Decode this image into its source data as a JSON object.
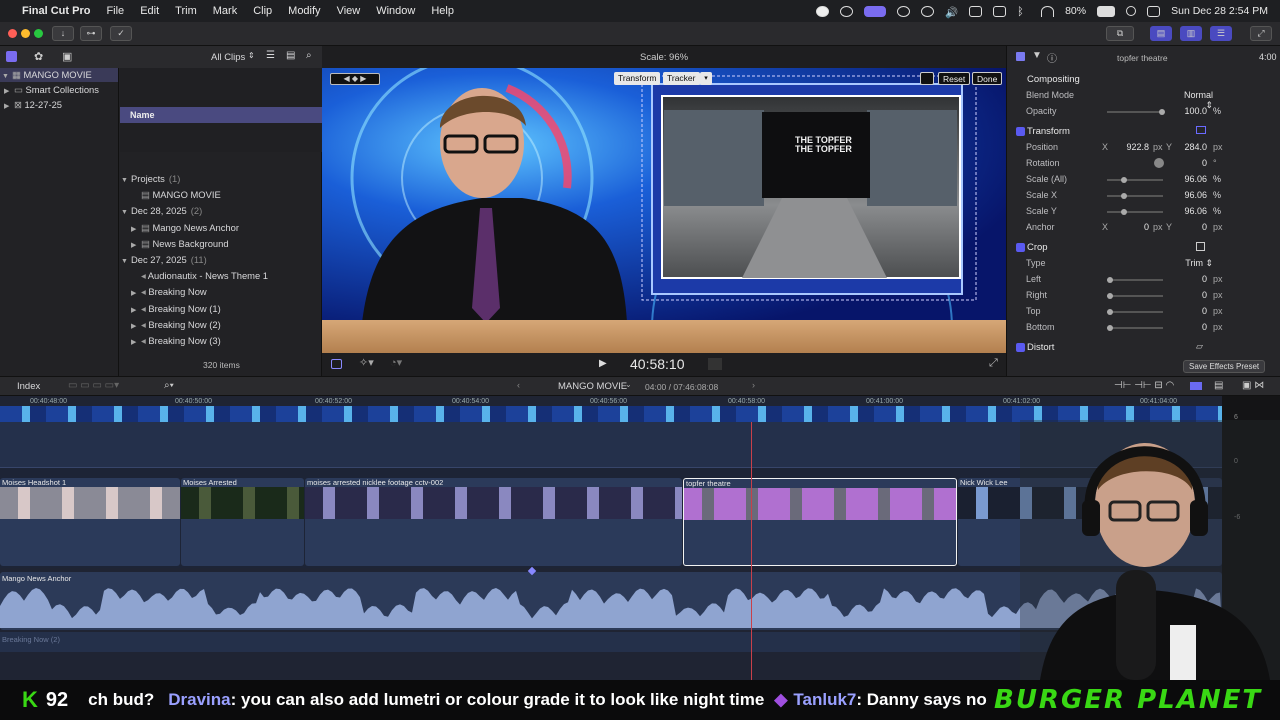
{
  "menubar": {
    "app": "Final Cut Pro",
    "items": [
      "File",
      "Edit",
      "Trim",
      "Mark",
      "Clip",
      "Modify",
      "View",
      "Window",
      "Help"
    ],
    "battery": "80%",
    "datetime": "Sun Dec 28  2:54 PM"
  },
  "browser": {
    "filter": "All Clips",
    "library": "MANGO MOVIE",
    "library_items": [
      "Smart Collections",
      "12-27-25"
    ],
    "column_name": "Name",
    "rows": [
      {
        "label": "Projects",
        "count": "(1)",
        "level": 0,
        "group": true
      },
      {
        "label": "MANGO MOVIE",
        "level": 1
      },
      {
        "label": "Dec 28, 2025",
        "count": "(2)",
        "level": 0,
        "group": true
      },
      {
        "label": "Mango News Anchor",
        "level": 1
      },
      {
        "label": "News Background",
        "level": 1
      },
      {
        "label": "Dec 27, 2025",
        "count": "(11)",
        "level": 0,
        "group": true
      },
      {
        "label": "Audionautix - News Theme 1",
        "level": 1
      },
      {
        "label": "Breaking Now",
        "level": 1
      },
      {
        "label": "Breaking Now (1)",
        "level": 1
      },
      {
        "label": "Breaking Now (2)",
        "level": 1
      },
      {
        "label": "Breaking Now (3)",
        "level": 1
      }
    ],
    "items_count": "320 items"
  },
  "viewer": {
    "scale": "Scale: 96%",
    "transform_btn": "Transform",
    "tracker_btn": "Tracker",
    "reset_btn": "Reset",
    "done_btn": "Done",
    "timecode": "40:58:10",
    "screen_text": "THE TOPFER"
  },
  "inspector": {
    "clip": "topfer theatre",
    "duration": "4:00",
    "compositing": "Compositing",
    "blend_label": "Blend Mode",
    "blend_value": "Normal",
    "opacity_label": "Opacity",
    "opacity_value": "100.0",
    "transform": "Transform",
    "position_label": "Position",
    "pos_x": "922.8",
    "pos_y": "284.0",
    "rotation_label": "Rotation",
    "rotation_value": "0",
    "scale_all_label": "Scale (All)",
    "scale_all": "96.06",
    "scale_x_label": "Scale X",
    "scale_x": "96.06",
    "scale_y_label": "Scale Y",
    "scale_y": "96.06",
    "anchor_label": "Anchor",
    "anchor_x": "0",
    "anchor_y": "0",
    "crop": "Crop",
    "type_label": "Type",
    "type_value": "Trim",
    "left_label": "Left",
    "right_label": "Right",
    "top_label": "Top",
    "bottom_label": "Bottom",
    "crop_value": "0",
    "distort": "Distort",
    "save_preset": "Save Effects Preset",
    "unit_px": "px",
    "unit_pct": "%",
    "unit_deg": "°",
    "x": "X",
    "y": "Y"
  },
  "timeline": {
    "index": "Index",
    "project": "MANGO MOVIE",
    "duration": "04:00 / 07:46:08:08",
    "ruler": [
      "00:40:48:00",
      "00:40:50:00",
      "00:40:52:00",
      "00:40:54:00",
      "00:40:56:00",
      "00:40:58:00",
      "00:41:00:00",
      "00:41:02:00",
      "00:41:04:00"
    ],
    "clips": [
      {
        "name": "Moises Headshot 1"
      },
      {
        "name": "Moises Arrested"
      },
      {
        "name": "moises arrested nicklee footage cctv-002"
      },
      {
        "name": "topfer theatre"
      },
      {
        "name": "Nick Wick Lee"
      }
    ],
    "audio_clip": "Mango News Anchor",
    "audio_clip2": "Breaking Now (2)",
    "meter_labels": [
      "6",
      "0",
      "-6"
    ]
  },
  "stream": {
    "score_letter": "K",
    "score": "92",
    "chat": [
      {
        "user": "",
        "text": "ch bud?"
      },
      {
        "user": "Dravina",
        "text": " : you can also add lumetri or colour grade it to look like night time"
      },
      {
        "user": "Tanluk7",
        "text": " : Danny says no 😂"
      }
    ],
    "sponsor": "BURGER PLANET"
  },
  "colors": {
    "accent": "#5a5af0",
    "chat_user": "#9aa0ff",
    "sponsor": "#39d814",
    "score": "#39d814",
    "clip_video": "#2f3f5e",
    "clip_audio": "#2e3b57"
  }
}
